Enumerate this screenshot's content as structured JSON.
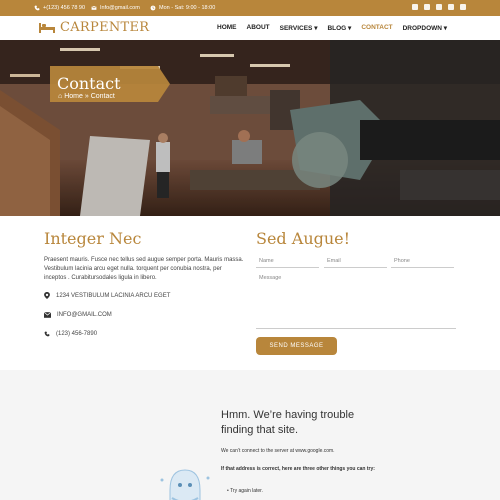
{
  "topbar": {
    "phone": "+(123) 456 78 90",
    "email": "Info@gmail.com",
    "hours": "Mon - Sat: 9:00 - 18:00"
  },
  "brand": {
    "name": "CARPENTER",
    "accent": "#b8863b"
  },
  "nav": {
    "home": "HOME",
    "about": "ABOUT",
    "services": "SERVICES",
    "blog": "BLOG",
    "contact": "CONTACT",
    "dropdown": "DROPDOWN"
  },
  "hero": {
    "title": "Contact",
    "crumb_home": "Home",
    "crumb_current": "Contact"
  },
  "info": {
    "heading": "Integer Nec",
    "paragraph": "Praesent mauris. Fusce nec tellus sed augue semper porta. Mauris massa. Vestibulum lacinia arcu eget nulla. torquent per conubia nostra, per inceptos . Curabitursodales ligula in libero.",
    "address": "1234 VESTIBULUM LACINIA ARCU EGET",
    "email": "INFO@GMAIL.COM",
    "phone": "(123) 456-7890"
  },
  "form": {
    "heading": "Sed Augue!",
    "name_placeholder": "Name",
    "email_placeholder": "Email",
    "phone_placeholder": "Phone",
    "message_placeholder": "Message",
    "submit": "SEND MESSAGE"
  },
  "map_error": {
    "title": "Hmm. We’re having trouble finding that site.",
    "line1": "We can’t connect to the server at www.google.com.",
    "line2": "If that address is correct, here are three other things you can try:",
    "line3": "Try again later."
  }
}
